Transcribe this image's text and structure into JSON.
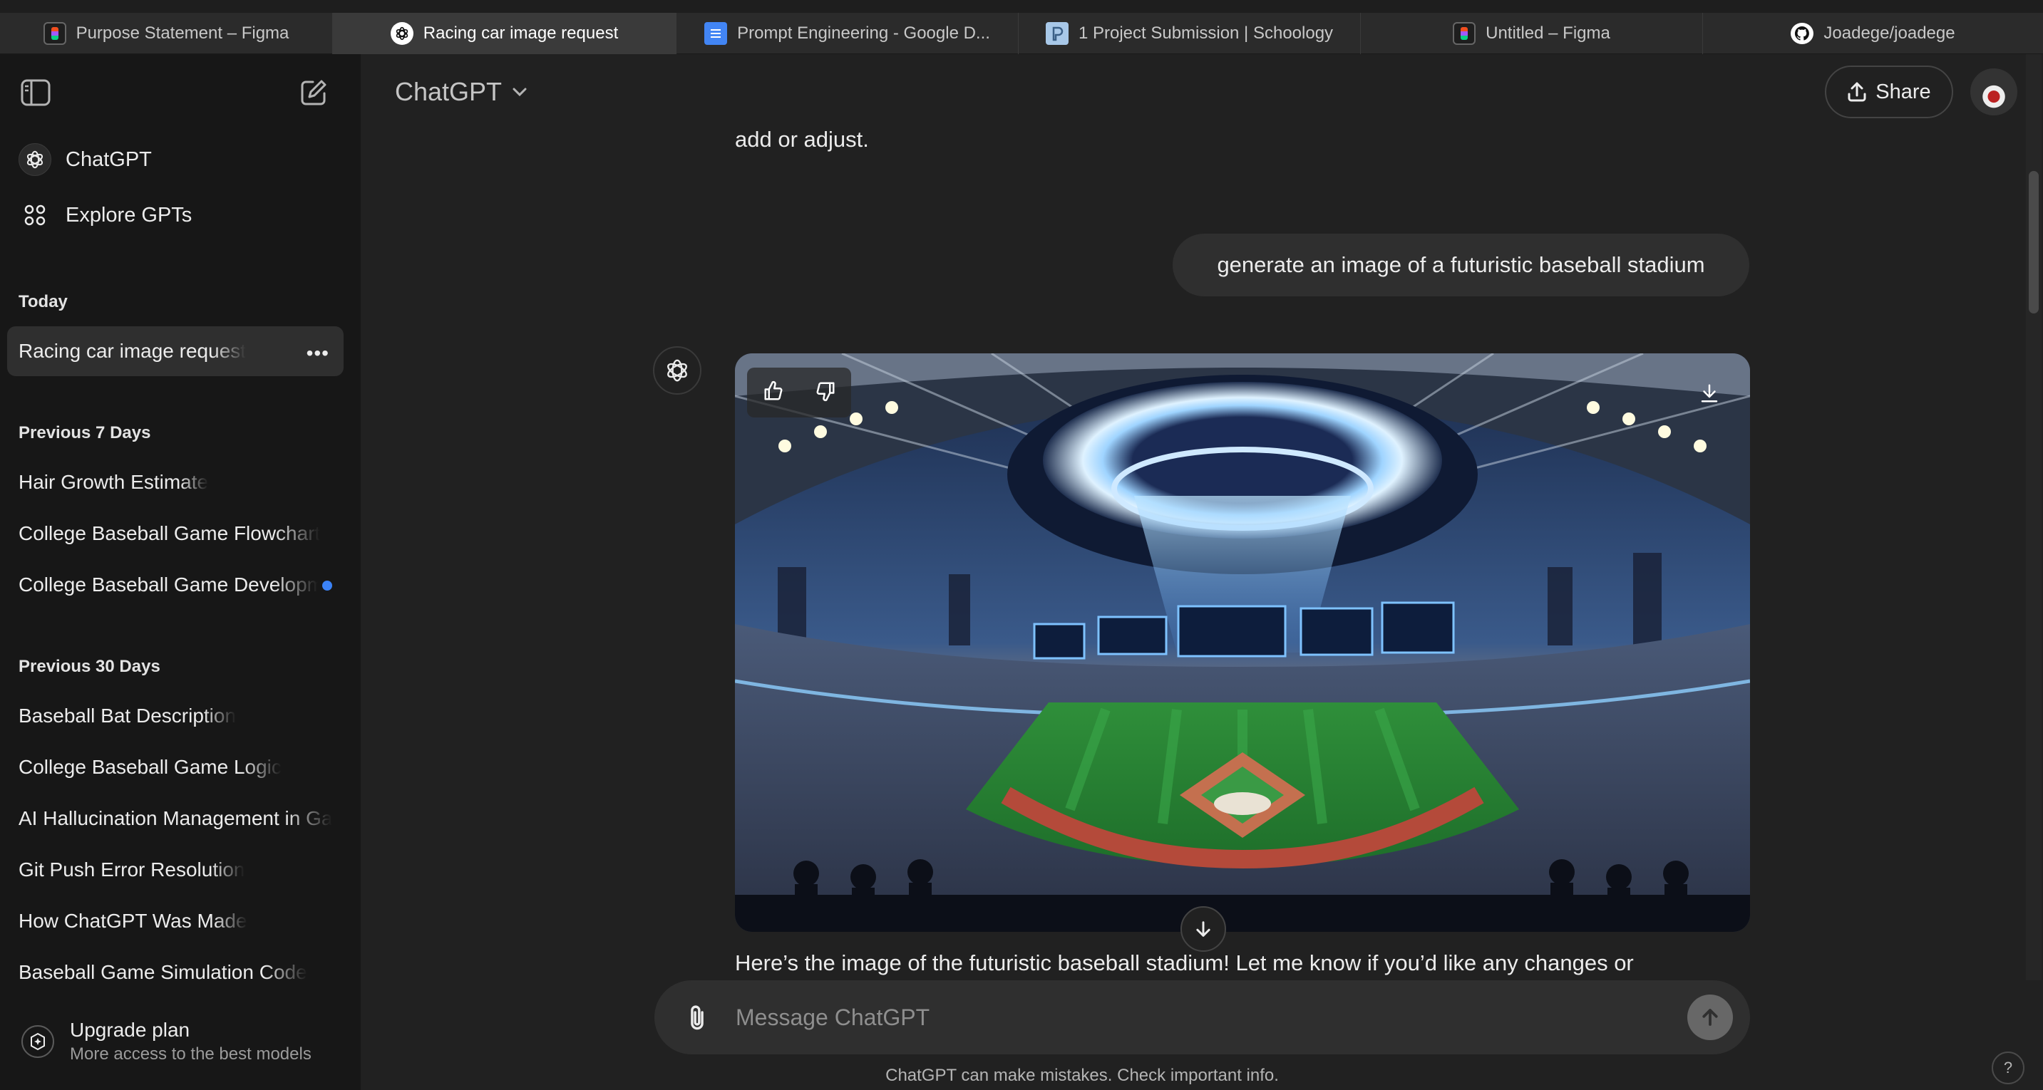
{
  "browser": {
    "tabs": [
      {
        "title": "Purpose Statement – Figma",
        "icon": "figma-icon"
      },
      {
        "title": "Racing car image request",
        "icon": "chatgpt-icon",
        "active": true
      },
      {
        "title": "Prompt Engineering - Google D...",
        "icon": "google-docs-icon"
      },
      {
        "title": "1 Project Submission | Schoology",
        "icon": "schoology-icon"
      },
      {
        "title": "Untitled – Figma",
        "icon": "figma-icon"
      },
      {
        "title": "Joadege/joadege",
        "icon": "github-icon"
      }
    ]
  },
  "sidebar": {
    "nav": [
      {
        "label": "ChatGPT",
        "icon": "chatgpt-logo-icon"
      },
      {
        "label": "Explore GPTs",
        "icon": "grid-icon"
      }
    ],
    "sections": [
      {
        "heading": "Today",
        "items": [
          {
            "label": "Racing car image request",
            "active": true
          }
        ]
      },
      {
        "heading": "Previous 7 Days",
        "items": [
          {
            "label": "Hair Growth Estimate"
          },
          {
            "label": "College Baseball Game Flowchart"
          },
          {
            "label": "College Baseball Game Development",
            "unread": true
          }
        ]
      },
      {
        "heading": "Previous 30 Days",
        "items": [
          {
            "label": "Baseball Bat Description"
          },
          {
            "label": "College Baseball Game Logic"
          },
          {
            "label": "AI Hallucination Management in Games"
          },
          {
            "label": "Git Push Error Resolution"
          },
          {
            "label": "How ChatGPT Was Made"
          },
          {
            "label": "Baseball Game Simulation Code"
          }
        ]
      }
    ],
    "upgrade": {
      "title": "Upgrade plan",
      "subtitle": "More access to the best models"
    }
  },
  "header": {
    "model_label": "ChatGPT",
    "share_label": "Share"
  },
  "conversation": {
    "previous_text_tail": "add or adjust.",
    "user_message": "generate an image of a futuristic baseball stadium",
    "assistant_reply": "Here’s the image of the futuristic baseball stadium! Let me know if you’d like any changes or"
  },
  "composer": {
    "placeholder": "Message ChatGPT"
  },
  "footer": {
    "disclaimer": "ChatGPT can make mistakes. Check important info.",
    "help": "?"
  },
  "colors": {
    "background": "#212121",
    "sidebar": "#171717",
    "bubble": "#2f2f2f",
    "unread_dot": "#3b82f6"
  }
}
